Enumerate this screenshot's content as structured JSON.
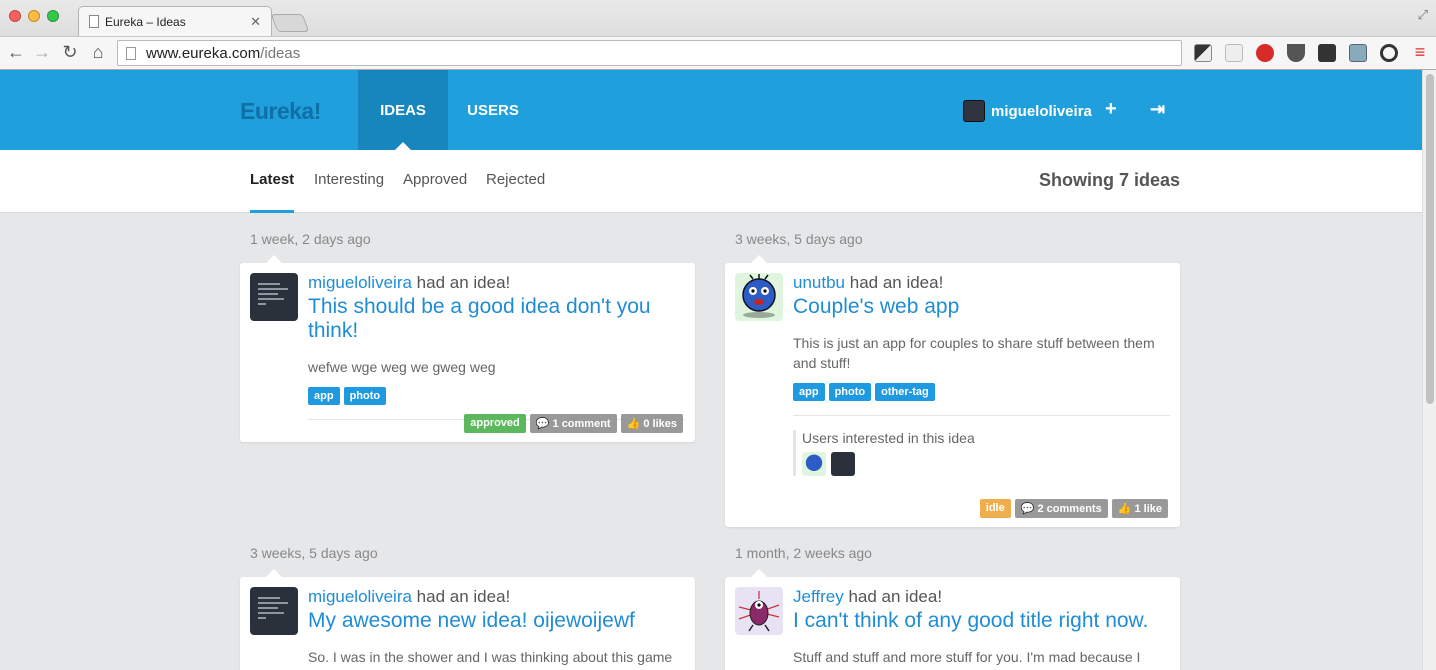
{
  "browser": {
    "tab_title": "Eureka – Ideas",
    "url_host": "www.eureka.com",
    "url_path": "/ideas"
  },
  "header": {
    "brand": "Eureka!",
    "nav": [
      {
        "label": "IDEAS",
        "active": true
      },
      {
        "label": "USERS",
        "active": false
      }
    ],
    "username": "migueloliveira",
    "add_icon": "plus-icon",
    "logout_icon": "sign-out-icon"
  },
  "filters": {
    "tabs": [
      {
        "label": "Latest",
        "active": true
      },
      {
        "label": "Interesting",
        "active": false
      },
      {
        "label": "Approved",
        "active": false
      },
      {
        "label": "Rejected",
        "active": false
      }
    ],
    "showing": "Showing 7 ideas"
  },
  "ideas": [
    {
      "time": "1 week, 2 days ago",
      "author": "migueloliveira",
      "had_idea": "had an idea!",
      "title": "This should be a good idea don't you think!",
      "description": "wefwe wge weg we gweg weg",
      "tags": [
        "app",
        "photo"
      ],
      "status": "approved",
      "comments": "1 comment",
      "likes": "0 likes"
    },
    {
      "time": "3 weeks, 5 days ago",
      "author": "unutbu",
      "had_idea": "had an idea!",
      "title": "Couple's web app",
      "description": "This is just an app for couples to share stuff between them and stuff!",
      "tags": [
        "app",
        "photo",
        "other-tag"
      ],
      "interested_label": "Users interested in this idea",
      "status": "idle",
      "comments": "2 comments",
      "likes": "1 like"
    },
    {
      "time": "3 weeks, 5 days ago",
      "author": "migueloliveira",
      "had_idea": "had an idea!",
      "title": "My awesome new idea! oijewoijewf",
      "description": "So. I was in the shower and I was thinking about this game"
    },
    {
      "time": "1 month, 2 weeks ago",
      "author": "Jeffrey",
      "had_idea": "had an idea!",
      "title": "I can't think of any good title right now.",
      "description": "Stuff and stuff and more stuff for you. I'm mad because I"
    }
  ],
  "colors": {
    "brand_blue": "#1fa0dc",
    "link_blue": "#1f8dd6",
    "approved_green": "#5cb85c",
    "idle_orange": "#f0ad4e"
  }
}
